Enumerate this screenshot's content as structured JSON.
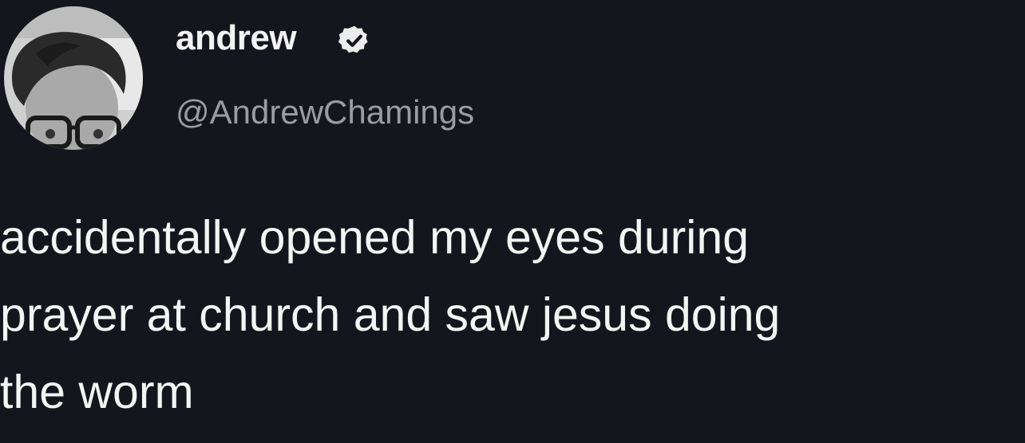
{
  "tweet": {
    "author": {
      "display_name": "andrew",
      "handle": "@AndrewChamings",
      "verified_icon": "verified-badge-icon",
      "avatar": "profile-photo"
    },
    "text_lines": [
      "accidentally opened my eyes during",
      "prayer at church and saw jesus doing",
      "the worm"
    ]
  },
  "colors": {
    "background": "#15161d",
    "name": "#f2f2f2",
    "handle": "#9a9ca3",
    "text": "#f4f4f4",
    "badge": "#ececec"
  }
}
